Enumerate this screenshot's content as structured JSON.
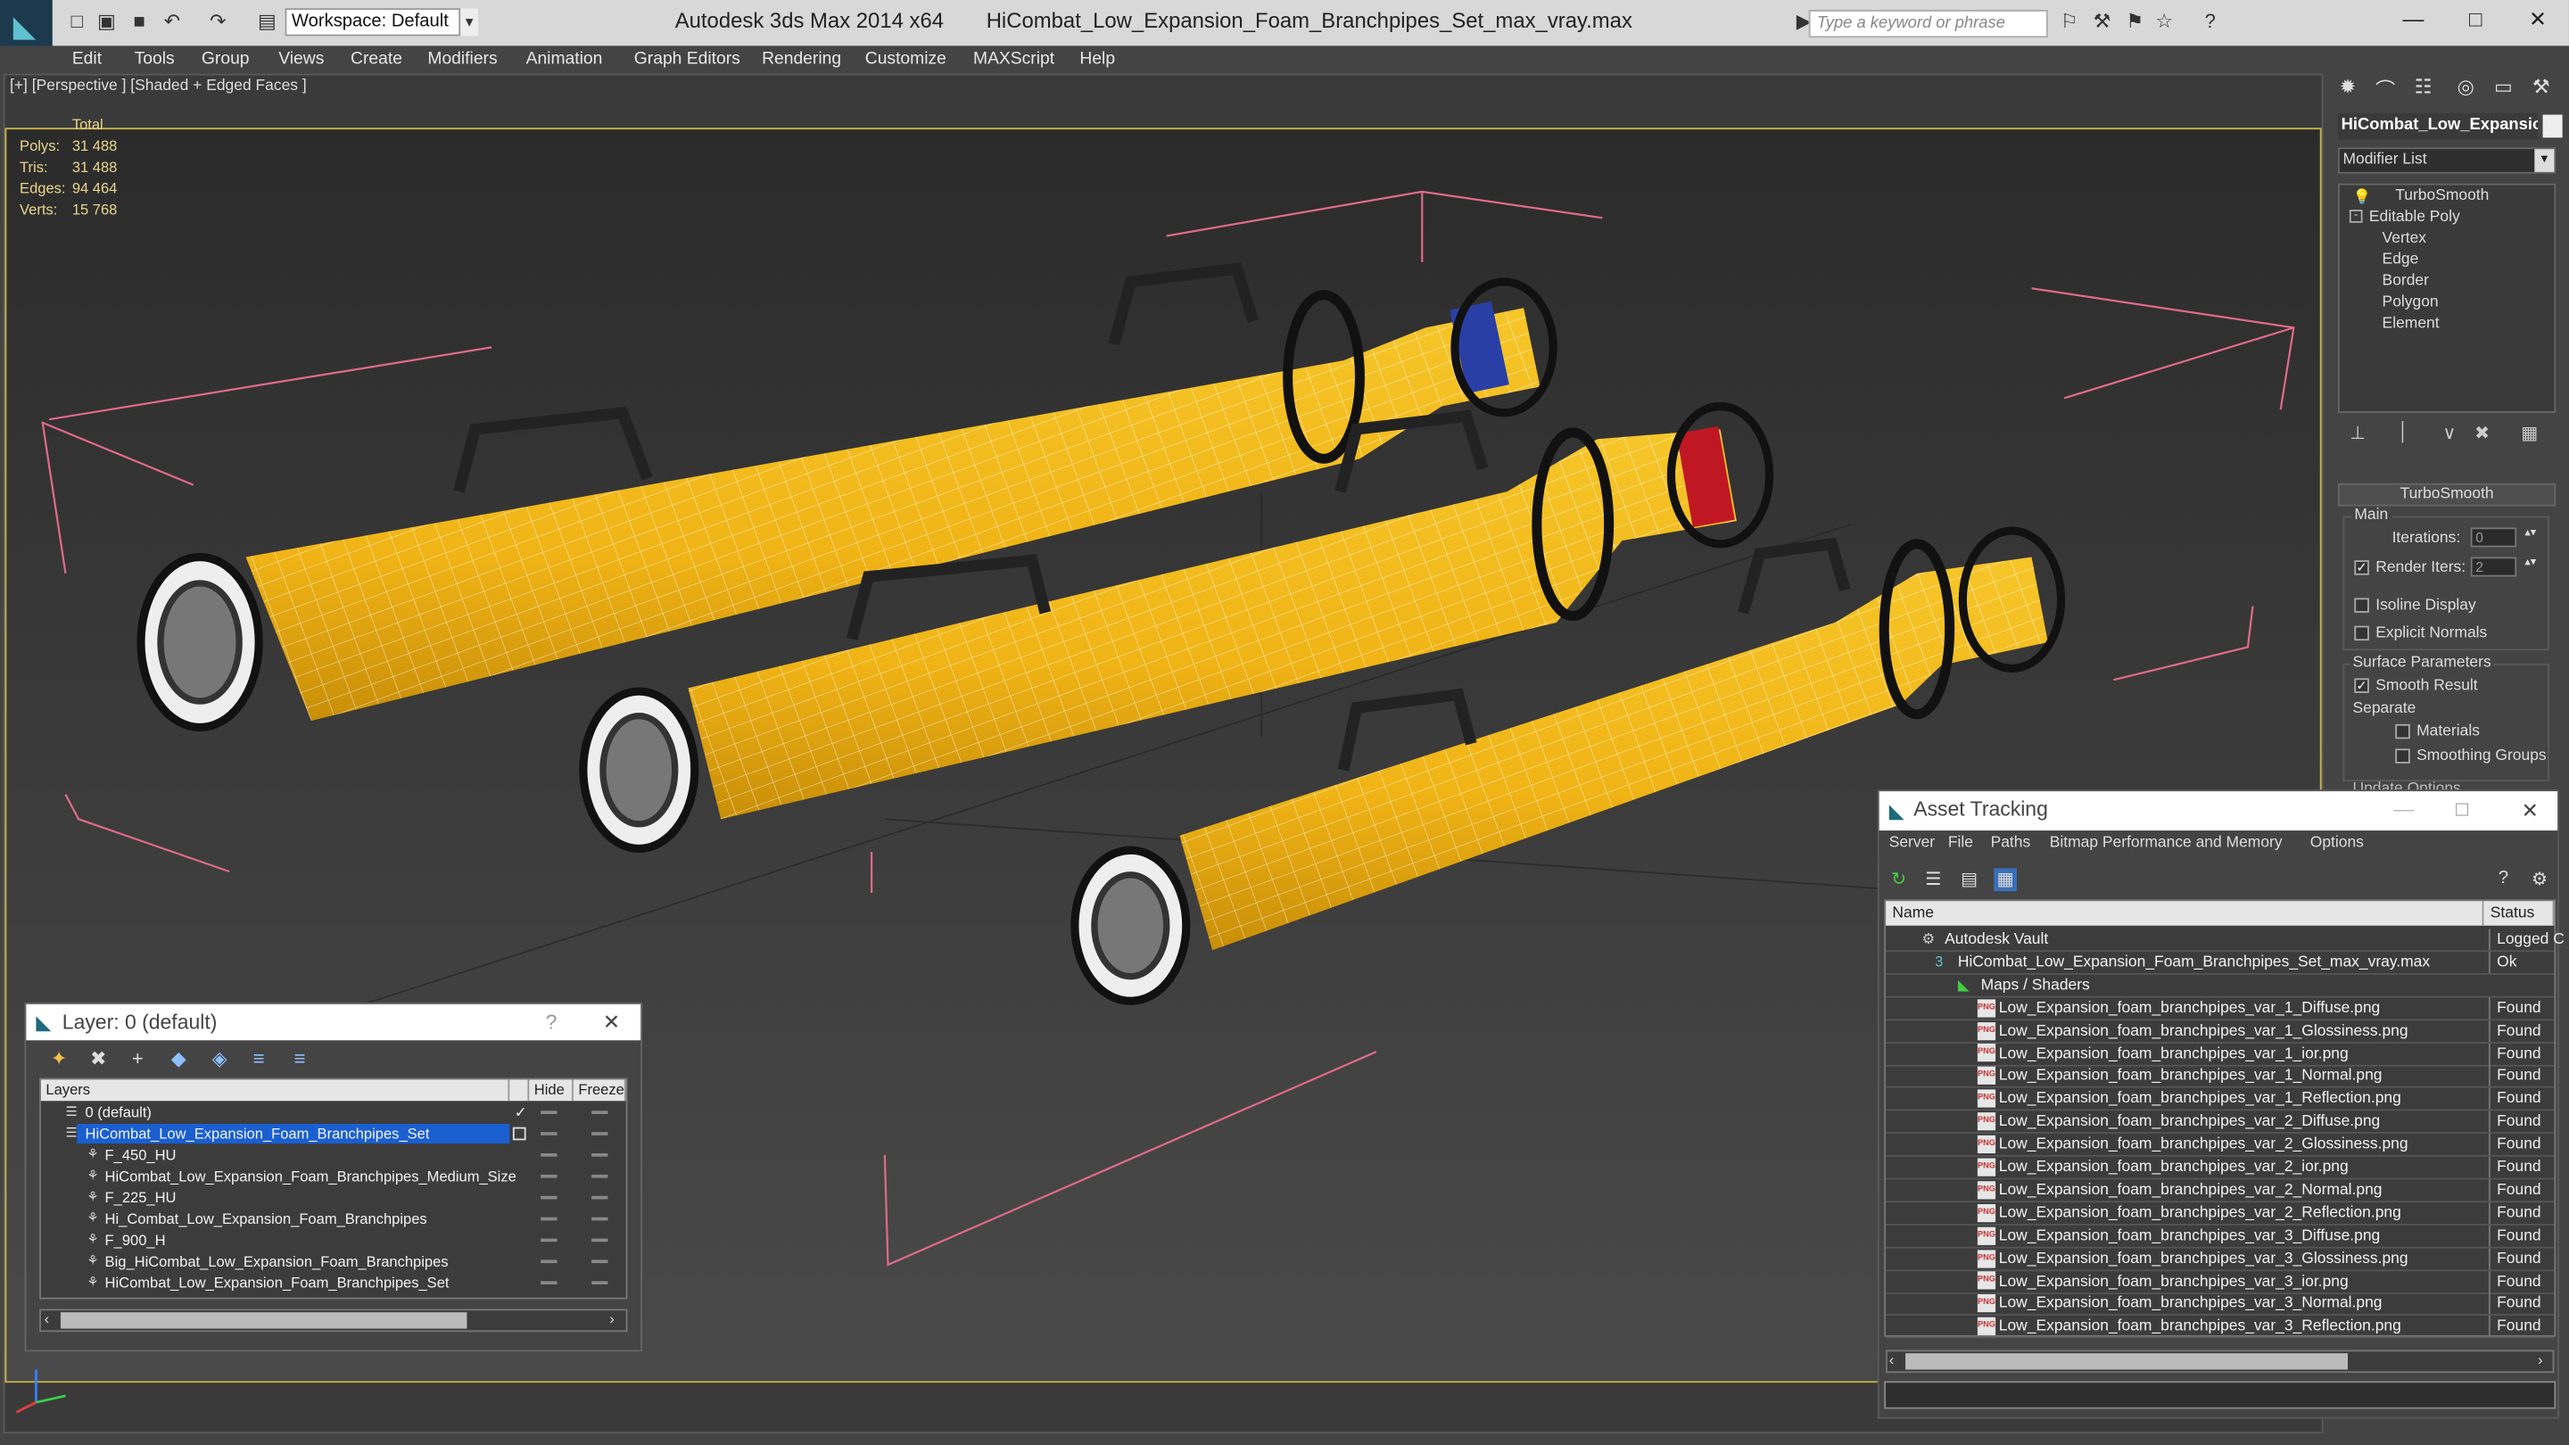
{
  "titlebar": {
    "workspace": "Workspace: Default",
    "app_title": "Autodesk 3ds Max  2014 x64",
    "file_title": "HiCombat_Low_Expansion_Foam_Branchpipes_Set_max_vray.max",
    "search_placeholder": "Type a keyword or phrase"
  },
  "menu": [
    "Edit",
    "Tools",
    "Group",
    "Views",
    "Create",
    "Modifiers",
    "Animation",
    "Graph Editors",
    "Rendering",
    "Customize",
    "MAXScript",
    "Help"
  ],
  "viewport": {
    "label": "[+] [Perspective ] [Shaded + Edged Faces ]",
    "stats_header": "Total",
    "stats": [
      {
        "name": "Polys:",
        "value": "31 488"
      },
      {
        "name": "Tris:",
        "value": "31 488"
      },
      {
        "name": "Edges:",
        "value": "94 464"
      },
      {
        "name": "Verts:",
        "value": "15 768"
      }
    ]
  },
  "command_panel": {
    "object_name": "HiCombat_Low_Expansio",
    "modifier_list": "Modifier List",
    "stack": [
      "TurboSmooth",
      "Editable Poly",
      "Vertex",
      "Edge",
      "Border",
      "Polygon",
      "Element"
    ],
    "rollout_title": "TurboSmooth",
    "main_label": "Main",
    "iterations_label": "Iterations:",
    "iterations_value": "0",
    "render_iters_label": "Render Iters:",
    "render_iters_value": "2",
    "isoline": "Isoline Display",
    "explicit_normals": "Explicit Normals",
    "surface_params": "Surface Parameters",
    "smooth_result": "Smooth Result",
    "separate": "Separate",
    "materials": "Materials",
    "smoothing_groups": "Smoothing Groups",
    "update_options": "Update Options"
  },
  "asset_tracking": {
    "title": "Asset Tracking",
    "menu": [
      "Server",
      "File",
      "Paths",
      "Bitmap Performance and Memory",
      "Options"
    ],
    "col_name": "Name",
    "col_status": "Status",
    "rows": [
      {
        "name": "Autodesk Vault",
        "status": "Logged C",
        "level": 0,
        "icon": "vault"
      },
      {
        "name": "HiCombat_Low_Expansion_Foam_Branchpipes_Set_max_vray.max",
        "status": "Ok",
        "level": 1,
        "icon": "max"
      },
      {
        "name": "Maps / Shaders",
        "status": "",
        "level": 2,
        "icon": "maps"
      },
      {
        "name": "Low_Expansion_foam_branchpipes_var_1_Diffuse.png",
        "status": "Found",
        "level": 3,
        "icon": "png"
      },
      {
        "name": "Low_Expansion_foam_branchpipes_var_1_Glossiness.png",
        "status": "Found",
        "level": 3,
        "icon": "png"
      },
      {
        "name": "Low_Expansion_foam_branchpipes_var_1_ior.png",
        "status": "Found",
        "level": 3,
        "icon": "png"
      },
      {
        "name": "Low_Expansion_foam_branchpipes_var_1_Normal.png",
        "status": "Found",
        "level": 3,
        "icon": "png"
      },
      {
        "name": "Low_Expansion_foam_branchpipes_var_1_Reflection.png",
        "status": "Found",
        "level": 3,
        "icon": "png"
      },
      {
        "name": "Low_Expansion_foam_branchpipes_var_2_Diffuse.png",
        "status": "Found",
        "level": 3,
        "icon": "png"
      },
      {
        "name": "Low_Expansion_foam_branchpipes_var_2_Glossiness.png",
        "status": "Found",
        "level": 3,
        "icon": "png"
      },
      {
        "name": "Low_Expansion_foam_branchpipes_var_2_ior.png",
        "status": "Found",
        "level": 3,
        "icon": "png"
      },
      {
        "name": "Low_Expansion_foam_branchpipes_var_2_Normal.png",
        "status": "Found",
        "level": 3,
        "icon": "png"
      },
      {
        "name": "Low_Expansion_foam_branchpipes_var_2_Reflection.png",
        "status": "Found",
        "level": 3,
        "icon": "png"
      },
      {
        "name": "Low_Expansion_foam_branchpipes_var_3_Diffuse.png",
        "status": "Found",
        "level": 3,
        "icon": "png"
      },
      {
        "name": "Low_Expansion_foam_branchpipes_var_3_Glossiness.png",
        "status": "Found",
        "level": 3,
        "icon": "png"
      },
      {
        "name": "Low_Expansion_foam_branchpipes_var_3_ior.png",
        "status": "Found",
        "level": 3,
        "icon": "png"
      },
      {
        "name": "Low_Expansion_foam_branchpipes_var_3_Normal.png",
        "status": "Found",
        "level": 3,
        "icon": "png"
      },
      {
        "name": "Low_Expansion_foam_branchpipes_var_3_Reflection.png",
        "status": "Found",
        "level": 3,
        "icon": "png"
      }
    ]
  },
  "layer_window": {
    "title": "Layer: 0 (default)",
    "col_layers": "Layers",
    "col_hide": "Hide",
    "col_freeze": "Freeze",
    "rows": [
      {
        "name": "0 (default)",
        "level": 0,
        "selected": false,
        "checked": true
      },
      {
        "name": "HiCombat_Low_Expansion_Foam_Branchpipes_Set",
        "level": 0,
        "selected": true,
        "checked": false
      },
      {
        "name": "F_450_HU",
        "level": 1,
        "selected": false,
        "checked": false
      },
      {
        "name": "HiCombat_Low_Expansion_Foam_Branchpipes_Medium_Size",
        "level": 1,
        "selected": false,
        "checked": false
      },
      {
        "name": "F_225_HU",
        "level": 1,
        "selected": false,
        "checked": false
      },
      {
        "name": "Hi_Combat_Low_Expansion_Foam_Branchpipes",
        "level": 1,
        "selected": false,
        "checked": false
      },
      {
        "name": "F_900_H",
        "level": 1,
        "selected": false,
        "checked": false
      },
      {
        "name": "Big_HiCombat_Low_Expansion_Foam_Branchpipes",
        "level": 1,
        "selected": false,
        "checked": false
      },
      {
        "name": "HiCombat_Low_Expansion_Foam_Branchpipes_Set",
        "level": 1,
        "selected": false,
        "checked": false
      }
    ]
  },
  "colors": {
    "pipe_yellow": "#f0b416",
    "band_blue": "#2a3fa6",
    "band_red": "#c01822",
    "selection_blue": "#1a5fd0",
    "viewport_border": "#c8b447"
  }
}
